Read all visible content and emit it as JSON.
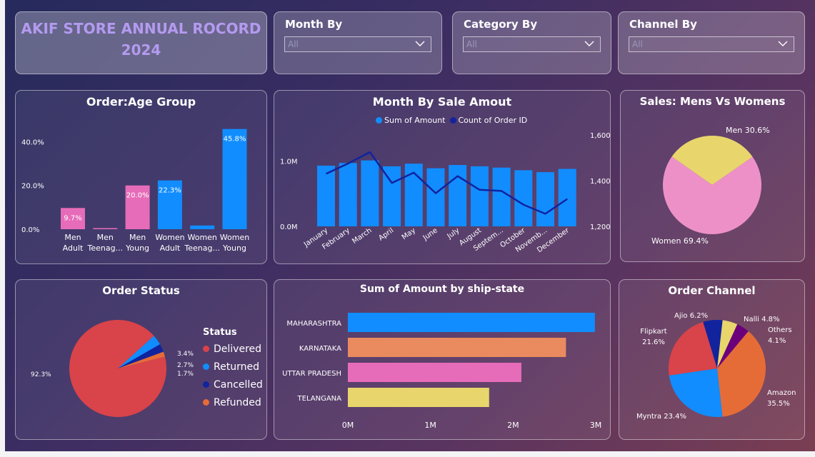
{
  "header": {
    "title_line1": "AKIF STORE ANNUAL ROCORD",
    "title_line2": "2024"
  },
  "slicers": [
    {
      "label": "Month By",
      "value": "All"
    },
    {
      "label": "Category By",
      "value": "All"
    },
    {
      "label": "Channel By",
      "value": "All"
    }
  ],
  "age_card": {
    "title": "Order:Age Group"
  },
  "month_card": {
    "title": "Month By Sale Amout"
  },
  "gender_card": {
    "title": "Sales: Mens Vs Womens"
  },
  "status_card": {
    "title": "Order Status"
  },
  "state_card": {
    "title": "Sum of Amount by ship-state"
  },
  "channel_card": {
    "title": "Order Channel"
  },
  "colors": {
    "blue": "#118DFF",
    "navy": "#12239E",
    "pink": "#E66CB9",
    "red": "#D9434A",
    "orange": "#E66C37",
    "salmon": "#E98B5F",
    "yellow": "#E8D66C",
    "purple": "#6B007B",
    "women_pink": "#EE90C8"
  },
  "chart_data": [
    {
      "id": "age",
      "type": "bar",
      "title": "Order:Age Group",
      "categories": [
        [
          "Men",
          "Adult"
        ],
        [
          "Men",
          "Teenag..."
        ],
        [
          "Men",
          "Young"
        ],
        [
          "Women",
          "Adult"
        ],
        [
          "Women",
          "Teenag..."
        ],
        [
          "Women",
          "Young"
        ]
      ],
      "values": [
        9.7,
        0.5,
        20.0,
        22.3,
        1.7,
        45.8
      ],
      "labels": [
        "9.7%",
        "",
        "20.0%",
        "22.3%",
        "",
        "45.8%"
      ],
      "colors": [
        "#E66CB9",
        "#E66CB9",
        "#E66CB9",
        "#118DFF",
        "#118DFF",
        "#118DFF"
      ],
      "yticks": [
        "0.0%",
        "20.0%",
        "40.0%"
      ],
      "ylim": [
        0,
        47
      ]
    },
    {
      "id": "month",
      "type": "bar",
      "title": "Month By Sale Amout",
      "categories": [
        "January",
        "February",
        "March",
        "April",
        "May",
        "June",
        "July",
        "August",
        "Septem...",
        "October",
        "Novemb...",
        "December"
      ],
      "series": [
        {
          "name": "Sum of Amount",
          "values": [
            0.93,
            0.97,
            1.01,
            0.92,
            0.96,
            0.89,
            0.94,
            0.92,
            0.9,
            0.86,
            0.83,
            0.88
          ]
        },
        {
          "name": "Count of Order ID",
          "values": [
            1430,
            1475,
            1525,
            1390,
            1435,
            1345,
            1420,
            1360,
            1355,
            1295,
            1255,
            1320
          ]
        }
      ],
      "yticks_left": [
        "0.0M",
        "1.0M"
      ],
      "yticks_right": [
        "1,200",
        "1,400",
        "1,600"
      ],
      "ylim_left": [
        0,
        1.4
      ],
      "ylim_right": [
        1200,
        1600
      ]
    },
    {
      "id": "gender",
      "type": "pie",
      "title": "Sales: Mens Vs Womens",
      "slices": [
        {
          "name": "Men",
          "value": 30.6,
          "label": "Men 30.6%",
          "color": "#E8D66C"
        },
        {
          "name": "Women",
          "value": 69.4,
          "label": "Women 69.4%",
          "color": "#EE90C8"
        }
      ]
    },
    {
      "id": "status",
      "type": "pie",
      "title": "Order Status",
      "legend_title": "Status",
      "slices": [
        {
          "name": "Delivered",
          "value": 92.3,
          "label": "92.3%",
          "color": "#D9434A"
        },
        {
          "name": "Returned",
          "value": 3.4,
          "label": "3.4%",
          "color": "#118DFF"
        },
        {
          "name": "Cancelled",
          "value": 2.7,
          "label": "2.7%",
          "color": "#12239E"
        },
        {
          "name": "Refunded",
          "value": 1.7,
          "label": "1.7%",
          "color": "#E66C37"
        }
      ]
    },
    {
      "id": "state",
      "type": "bar",
      "orientation": "horizontal",
      "title": "Sum of Amount by ship-state",
      "categories": [
        "MAHARASHTRA",
        "KARNATAKA",
        "UTTAR PRADESH",
        "TELANGANA"
      ],
      "values": [
        2.99,
        2.64,
        2.1,
        1.71
      ],
      "colors": [
        "#118DFF",
        "#E98B5F",
        "#E66CB9",
        "#E8D66C"
      ],
      "xticks": [
        "0M",
        "1M",
        "2M",
        "3M"
      ],
      "xlim": [
        0,
        3
      ]
    },
    {
      "id": "channel",
      "type": "pie",
      "title": "Order Channel",
      "slices": [
        {
          "name": "Amazon",
          "value": 35.5,
          "label": [
            "Amazon",
            "35.5%"
          ],
          "color": "#E66C37"
        },
        {
          "name": "Myntra",
          "value": 23.4,
          "label": [
            "Myntra 23.4%"
          ],
          "color": "#118DFF"
        },
        {
          "name": "Flipkart",
          "value": 21.6,
          "label": [
            "Flipkart",
            "21.6%"
          ],
          "color": "#D9434A"
        },
        {
          "name": "Ajio",
          "value": 6.2,
          "label": [
            "Ajio 6.2%"
          ],
          "color": "#12239E"
        },
        {
          "name": "Nalli",
          "value": 4.8,
          "label": [
            "Nalli 4.8%"
          ],
          "color": "#E8D66C"
        },
        {
          "name": "Others",
          "value": 4.1,
          "label": [
            "Others",
            "4.1%"
          ],
          "color": "#6B007B"
        }
      ]
    }
  ]
}
